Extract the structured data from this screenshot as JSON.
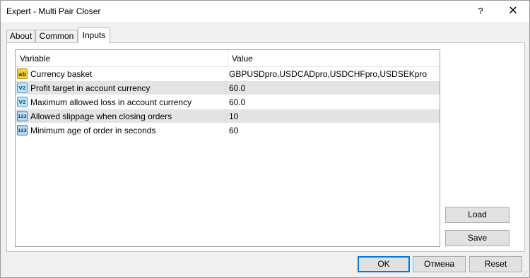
{
  "window": {
    "title": "Expert - Multi Pair Closer",
    "help_glyph": "?",
    "close_glyph": "✕"
  },
  "tabs": [
    {
      "label": "About"
    },
    {
      "label": "Common"
    },
    {
      "label": "Inputs",
      "active": true
    }
  ],
  "grid": {
    "columns": [
      "Variable",
      "Value"
    ],
    "rows": [
      {
        "icon": "string-icon",
        "icon_text": "ab",
        "variable": "Currency basket",
        "value": "GBPUSDpro,USDCADpro,USDCHFpro,USDSEKpro"
      },
      {
        "icon": "double-icon",
        "icon_text": "V2",
        "variable": "Profit target in account currency",
        "value": "60.0"
      },
      {
        "icon": "double-icon",
        "icon_text": "V2",
        "variable": "Maximum allowed loss in account currency",
        "value": "60.0"
      },
      {
        "icon": "integer-icon",
        "icon_text": "123",
        "variable": "Allowed slippage when closing orders",
        "value": "10"
      },
      {
        "icon": "integer-icon",
        "icon_text": "123",
        "variable": "Minimum age of order in seconds",
        "value": "60"
      }
    ]
  },
  "side_buttons": {
    "load": "Load",
    "save": "Save"
  },
  "footer_buttons": {
    "ok": "OK",
    "cancel": "Отмена",
    "reset": "Reset"
  }
}
